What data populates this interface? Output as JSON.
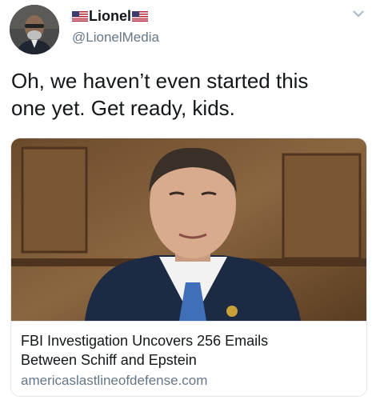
{
  "tweet": {
    "display_name": "Lionel",
    "handle": "@LionelMedia",
    "text": "Oh, we haven’t even started this\none yet. Get ready, kids."
  },
  "card": {
    "title": "FBI Investigation Uncovers 256 Emails\nBetween Schiff and Epstein",
    "domain": "americaslastlineofdefense.com"
  },
  "icons": {
    "left_flag": "us-flag-icon",
    "right_flag": "us-flag-icon",
    "menu": "chevron-down-icon"
  },
  "colors": {
    "text": "#14171a",
    "secondary_text": "#657786",
    "border": "#e1e8ed",
    "flag_red": "#b22234",
    "flag_blue": "#3c3b6e"
  }
}
